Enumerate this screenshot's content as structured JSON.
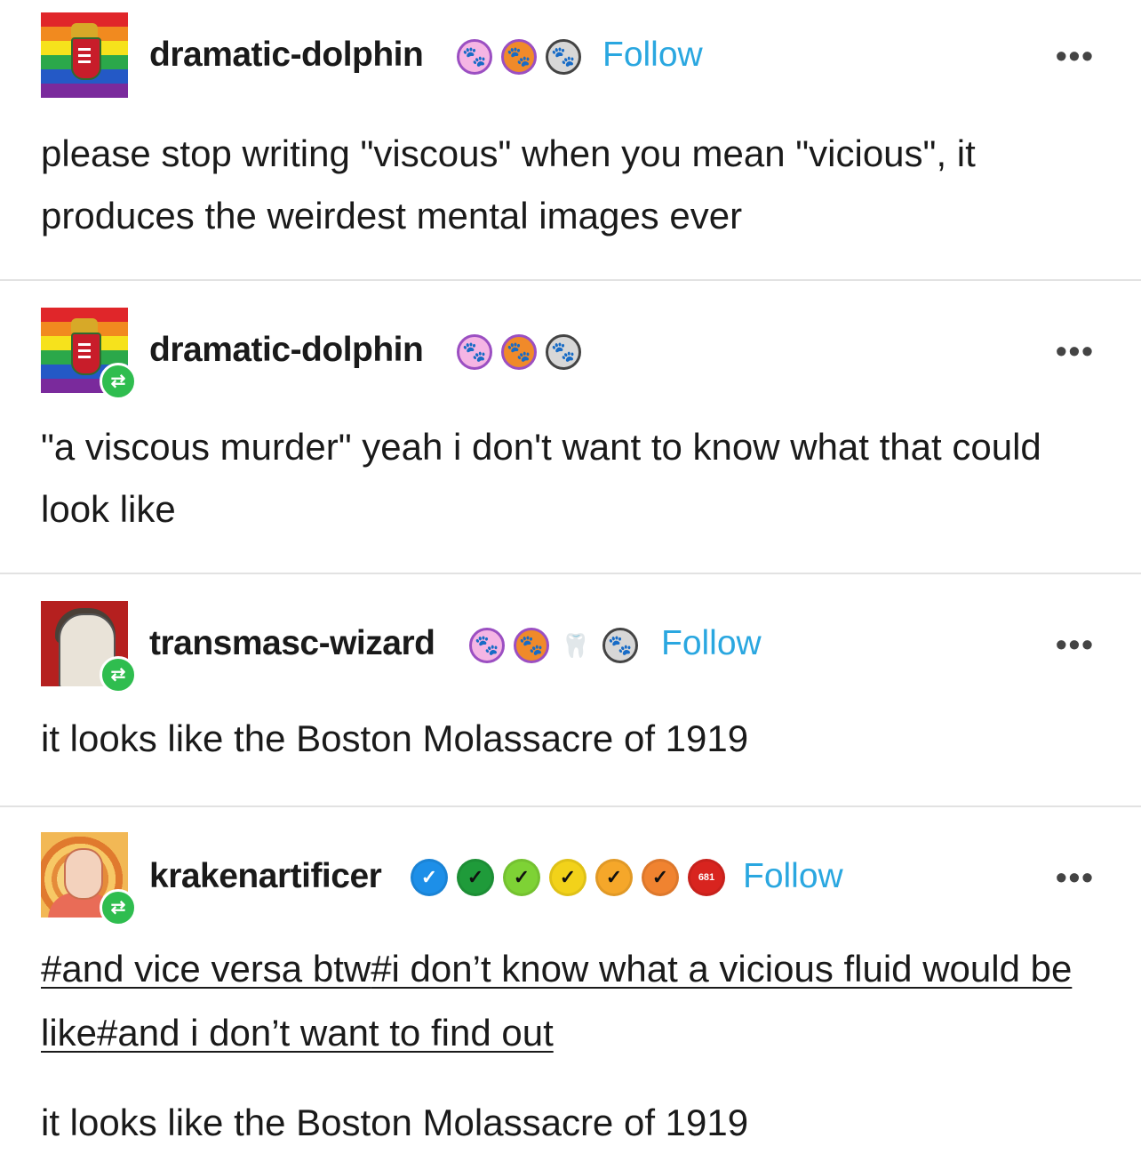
{
  "posts": [
    {
      "username": "dramatic-dolphin",
      "follow_label": "Follow",
      "more_label": "•••",
      "text": "please stop writing \"viscous\" when you mean \"vicious\", it produces the weirdest mental images ever"
    },
    {
      "username": "dramatic-dolphin",
      "more_label": "•••",
      "text": "\"a viscous murder\" yeah i don't want to know what that could look like"
    },
    {
      "username": "transmasc-wizard",
      "follow_label": "Follow",
      "more_label": "•••",
      "text": "it looks like the Boston Molassacre of 1919"
    },
    {
      "username": "krakenartificer",
      "follow_label": "Follow",
      "more_label": "•••",
      "tags": [
        "#and vice versa btw",
        "#i don’t know what a vicious fluid would be like",
        "#and i don’t want to find out"
      ],
      "text": "it looks like the Boston Molassacre of 1919"
    }
  ],
  "icons": {
    "reblog": "⇄",
    "paw": "🐾",
    "check": "✓",
    "badge_number": "681"
  },
  "colors": {
    "follow": "#2aa7e0",
    "reblog_badge": "#2fbd4f"
  }
}
